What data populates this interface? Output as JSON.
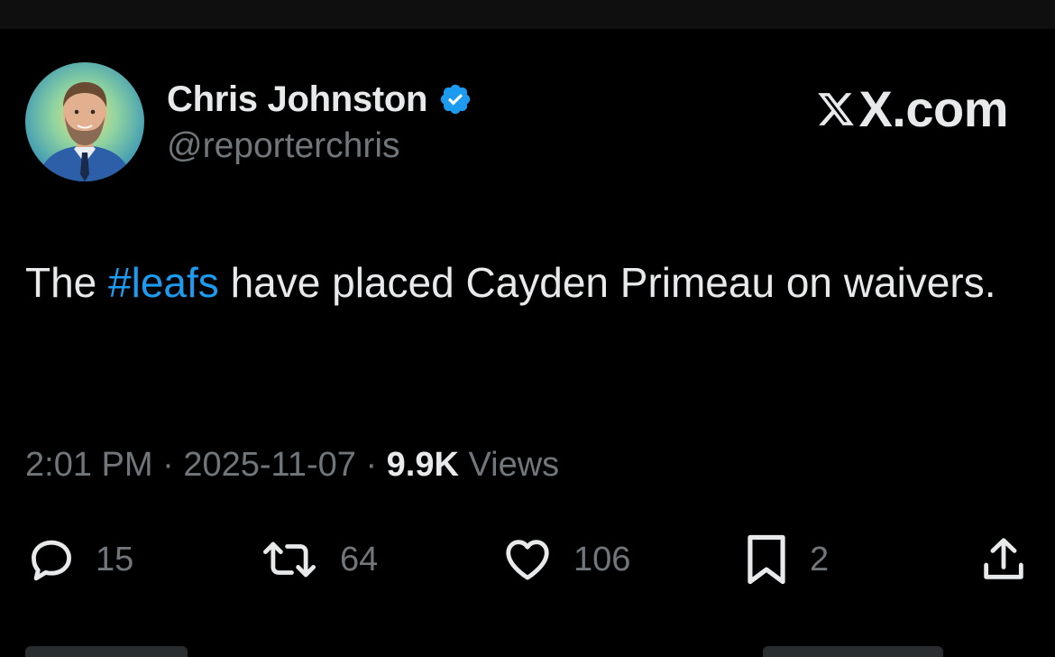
{
  "author": {
    "display_name": "Chris Johnston",
    "handle": "@reporterchris",
    "verified": true,
    "avatar_icon": "profile-photo"
  },
  "brand": {
    "text": "X.com",
    "icon": "x-logo-icon"
  },
  "tweet": {
    "text_before": "The ",
    "hashtag": "#leafs",
    "text_after": " have placed Cayden Primeau on waivers."
  },
  "meta": {
    "time": "2:01 PM",
    "separator": "·",
    "date": "2025-11-07",
    "views_count": "9.9K",
    "views_label": "Views"
  },
  "actions": {
    "replies": "15",
    "reposts": "64",
    "likes": "106",
    "bookmarks": "2"
  },
  "colors": {
    "background": "#000000",
    "text": "#e7e9ea",
    "muted": "#71767b",
    "accent": "#1d9bf0"
  }
}
